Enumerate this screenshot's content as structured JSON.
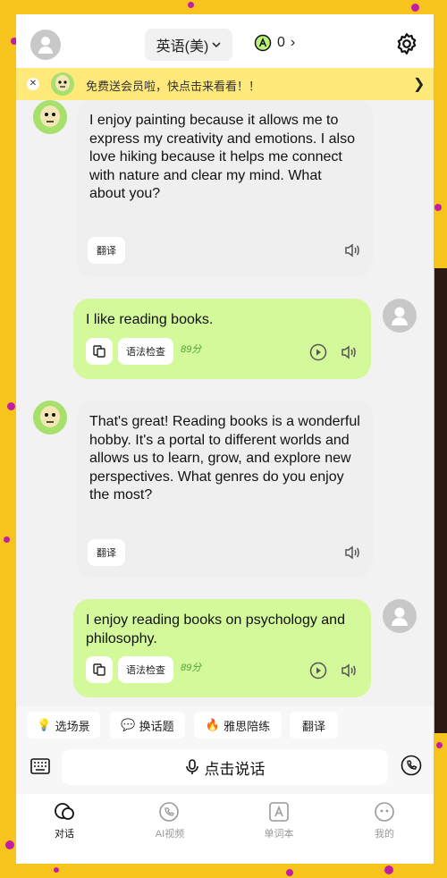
{
  "header": {
    "language": "英语(美)",
    "points": "0",
    "accent_color": "#b9f37a"
  },
  "banner": {
    "text": "免费送会员啦，快点击来看看！！"
  },
  "messages": [
    {
      "role": "ai",
      "text": "I enjoy painting because it allows me to express my creativity and emotions. I also love hiking because it helps me connect with nature and clear my mind. What about you?",
      "translate_label": "翻译"
    },
    {
      "role": "user",
      "text": "I like reading books.",
      "grammar_label": "语法检查",
      "score": "89分"
    },
    {
      "role": "ai",
      "text": "That's great! Reading books is a wonderful hobby. It's a portal to different worlds and allows us to learn, grow, and explore new perspectives. What genres do you enjoy the most?",
      "translate_label": "翻译"
    },
    {
      "role": "user",
      "text": "I enjoy reading books on psychology and philosophy.",
      "grammar_label": "语法检查",
      "score": "89分"
    }
  ],
  "quick_actions": [
    {
      "icon": "💡",
      "label": "选场景"
    },
    {
      "icon": "💬",
      "label": "换话题"
    },
    {
      "icon": "🔥",
      "label": "雅思陪练"
    },
    {
      "icon": "",
      "label": "翻译"
    }
  ],
  "input": {
    "talk_label": "点击说话"
  },
  "tabs": [
    {
      "label": "对话",
      "icon": "chat-icon",
      "active": true
    },
    {
      "label": "AI视频",
      "icon": "video-call-icon",
      "active": false
    },
    {
      "label": "单词本",
      "icon": "vocab-icon",
      "active": false
    },
    {
      "label": "我的",
      "icon": "profile-icon",
      "active": false
    }
  ]
}
